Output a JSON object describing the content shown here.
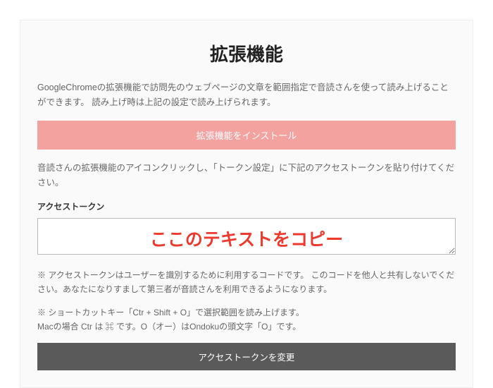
{
  "title": "拡張機能",
  "description": "GoogleChromeの拡張機能で訪問先のウェブページの文章を範囲指定で音読さんを使って読み上げることができます。 読み上げ時は上記の設定で読み上げられます。",
  "install_button": "拡張機能をインストール",
  "instruction": "音読さんの拡張機能のアイコンクリックし、「トークン設定」に下記のアクセストークンを貼り付けてください。",
  "token_label": "アクセストークン",
  "token_value": "",
  "overlay": "ここのテキストをコピー",
  "note1": "※ アクセストークンはユーザーを識別するために利用するコードです。 このコードを他人と共有しないでください。あなたになりすまして第三者が音読さんを利用できるようになります。",
  "note2": "※ ショートカットキー「Ctr + Shift + O」で選択範囲を読み上げます。\nMacの場合 Ctr は ⌘ です。O（オー）はOndokuの頭文字「O」です。",
  "change_button": "アクセストークンを変更"
}
